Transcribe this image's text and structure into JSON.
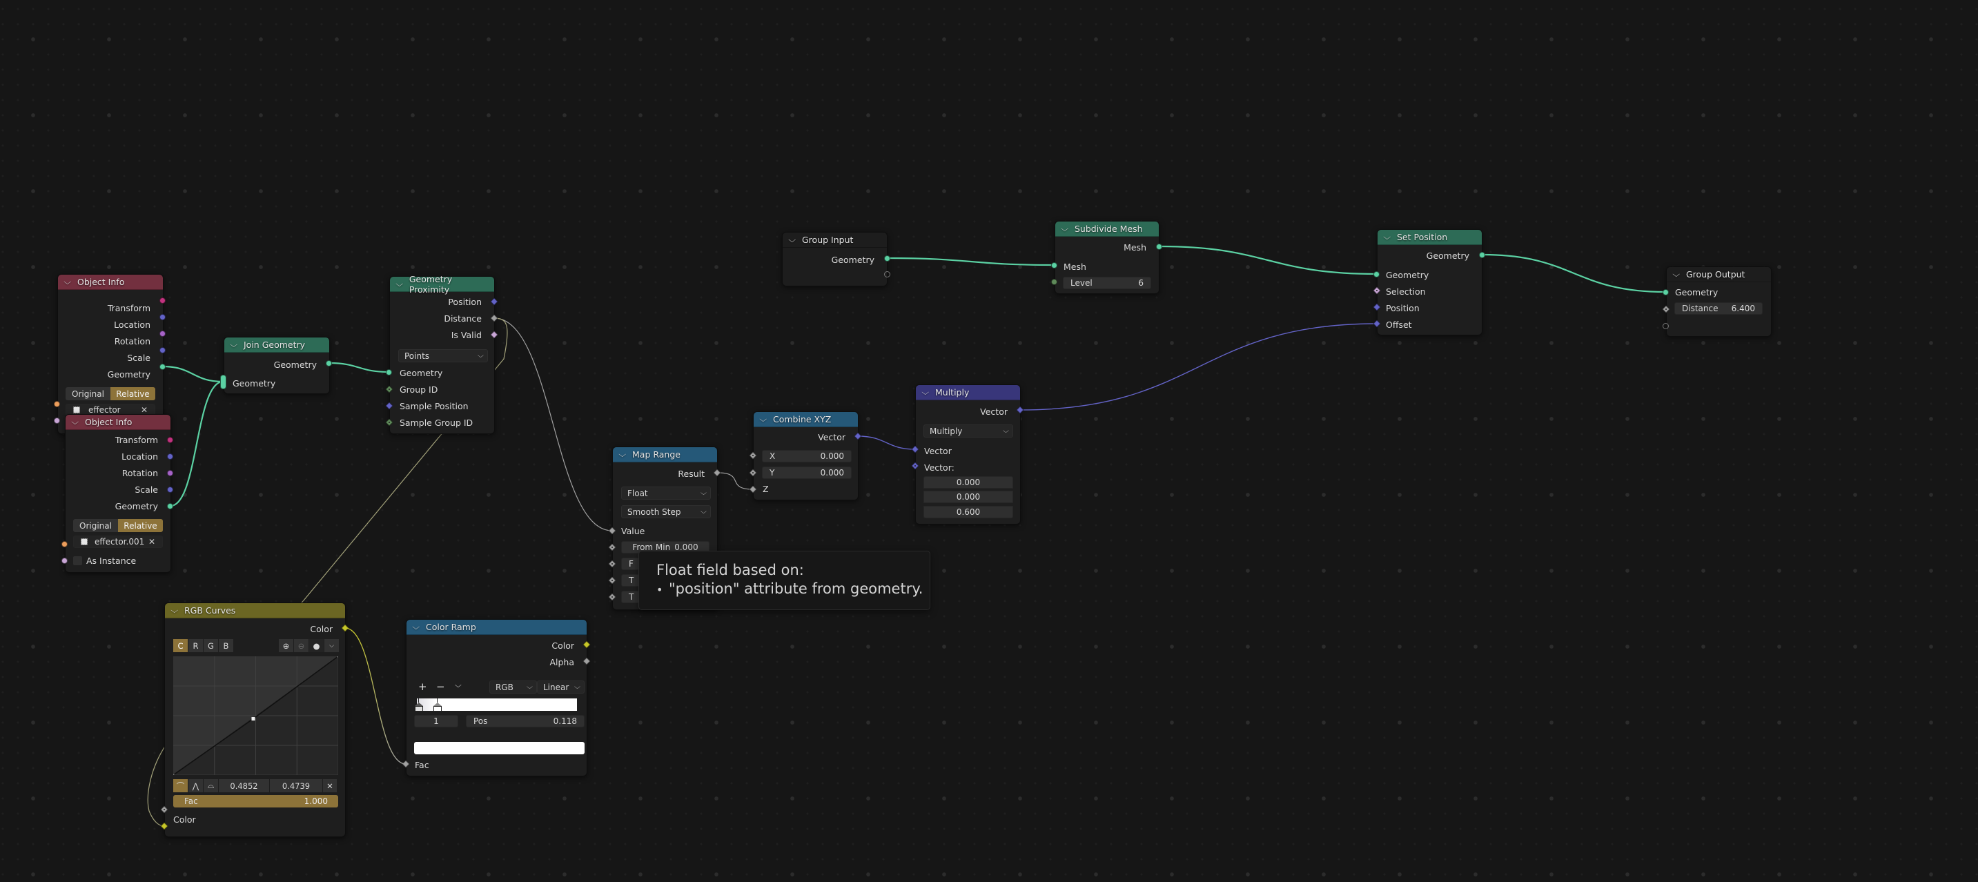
{
  "editor": "Geometry Node Editor",
  "colors": {
    "geometry_socket": "#5bd1a3",
    "vector_socket": "#6363c7",
    "float_socket": "#a1a1a1",
    "boolean_socket": "#c9a6d6",
    "integer_socket": "#5f8a5a",
    "color_socket": "#c7c729",
    "matrix_socket": "#c2337f",
    "rotation_socket": "#a663c7",
    "object_socket": "#ed9e5c",
    "header_geometry": "#2d6b56",
    "header_object": "#73303f",
    "header_converter": "#255878",
    "header_vector": "#38367a",
    "header_color": "#6b6623",
    "active_toggle": "#8d7339"
  },
  "nodes": {
    "object_info_1": {
      "title": "Object Info",
      "outputs": [
        "Transform",
        "Location",
        "Rotation",
        "Scale",
        "Geometry"
      ],
      "transform_space": {
        "options": [
          "Original",
          "Relative"
        ],
        "selected": "Relative"
      },
      "object": "effector"
    },
    "object_info_2": {
      "title": "Object Info",
      "outputs": [
        "Transform",
        "Location",
        "Rotation",
        "Scale",
        "Geometry"
      ],
      "transform_space": {
        "options": [
          "Original",
          "Relative"
        ],
        "selected": "Relative"
      },
      "object": "effector.001",
      "as_instance_label": "As Instance",
      "as_instance": false
    },
    "join_geometry": {
      "title": "Join Geometry",
      "output": "Geometry",
      "input": "Geometry"
    },
    "geometry_proximity": {
      "title": "Geometry Proximity",
      "outputs": [
        "Position",
        "Distance",
        "Is Valid"
      ],
      "target_element": "Points",
      "inputs": [
        "Geometry",
        "Group ID",
        "Sample Position",
        "Sample Group ID"
      ]
    },
    "map_range": {
      "title": "Map Range",
      "output": "Result",
      "data_type": "Float",
      "interpolation": "Smooth Step",
      "value_label": "Value",
      "from_min_label": "From Min",
      "from_min": "0.000",
      "hidden_rows": [
        "F",
        "T",
        "T"
      ]
    },
    "combine_xyz": {
      "title": "Combine XYZ",
      "output": "Vector",
      "x_label": "X",
      "x": "0.000",
      "y_label": "Y",
      "y": "0.000",
      "z_label": "Z"
    },
    "multiply": {
      "title": "Multiply",
      "output": "Vector",
      "operation": "Multiply",
      "input_a": "Vector",
      "input_b": "Vector:",
      "vector_b": [
        "0.000",
        "0.000",
        "0.600"
      ]
    },
    "group_input": {
      "title": "Group Input",
      "output": "Geometry"
    },
    "subdivide_mesh": {
      "title": "Subdivide Mesh",
      "output": "Mesh",
      "input": "Mesh",
      "level_label": "Level",
      "level": "6"
    },
    "set_position": {
      "title": "Set Position",
      "output": "Geometry",
      "inputs": [
        "Geometry",
        "Selection",
        "Position",
        "Offset"
      ]
    },
    "group_output": {
      "title": "Group Output",
      "input": "Geometry",
      "distance_label": "Distance",
      "distance": "6.400"
    },
    "rgb_curves": {
      "title": "RGB Curves",
      "output": "Color",
      "channels": [
        "C",
        "R",
        "G",
        "B"
      ],
      "active_channel": "C",
      "point_x": "0.4852",
      "point_y": "0.4739",
      "fac_label": "Fac",
      "fac": "1.000",
      "fac_fraction": 1.0,
      "input": "Color",
      "curve_points": [
        [
          0,
          0
        ],
        [
          0.4852,
          0.4739
        ],
        [
          1,
          1
        ]
      ]
    },
    "color_ramp": {
      "title": "Color Ramp",
      "outputs": [
        "Color",
        "Alpha"
      ],
      "add_label": "+",
      "remove_label": "−",
      "color_mode": "RGB",
      "interpolation": "Linear",
      "active_stop_index": "1",
      "pos_label": "Pos",
      "pos": "0.118",
      "stops": [
        0.0,
        0.118
      ],
      "input": "Fac"
    }
  },
  "tooltip": {
    "line1": "Float field based on:",
    "bullet": "•",
    "line2": "\"position\" attribute from geometry."
  }
}
